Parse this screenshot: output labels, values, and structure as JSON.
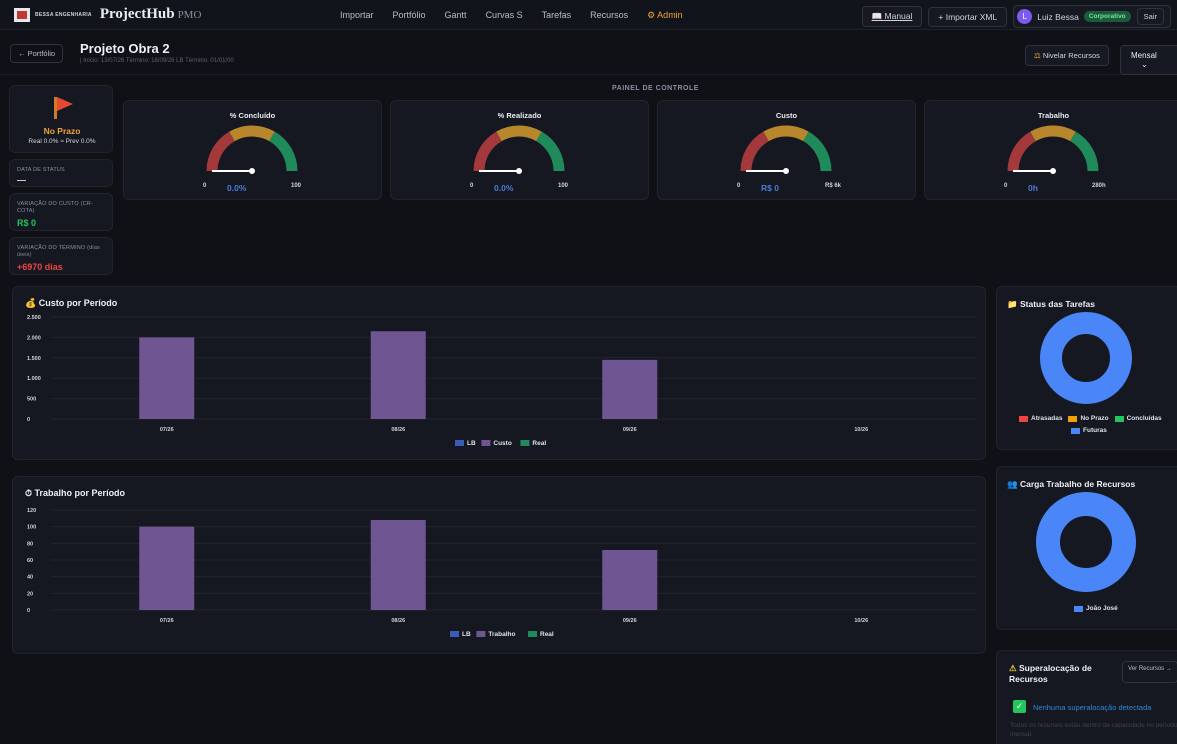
{
  "brand": {
    "small": "BESSA ENGENHARIA",
    "name_a": "Project",
    "name_b": "Hub",
    "suffix": "PMO"
  },
  "nav": {
    "items": [
      "Importar",
      "Portfólio",
      "Gantt",
      "Curvas S",
      "Tarefas",
      "Recursos"
    ],
    "admin": "⚙ Admin"
  },
  "top_actions": {
    "manual": "📖 Manual",
    "import_xml": "+ Importar XML",
    "avatar_letter": "L",
    "user_name": "Luiz Bessa",
    "plan_badge": "Corporativo",
    "logout": "Sair"
  },
  "project": {
    "back": "← Portfólio",
    "title": "Projeto Obra 2",
    "subtitle": "| Início: 13/07/26   Término: 18/09/26   LB Término: 01/01/00",
    "level_resources": "Nivelar Recursos",
    "period_select": "Mensal"
  },
  "status": {
    "label": "No Prazo",
    "detail": "Real 0.0% ≈ Prev 0.0%"
  },
  "info_cards": [
    {
      "label": "DATA DE STATUS",
      "value": "—",
      "color": "#d6d9e0"
    },
    {
      "label": "VARIAÇÃO DO CUSTO (CR-COTA)",
      "value": "R$ 0",
      "color": "#22c55e"
    },
    {
      "label": "VARIAÇÃO DO TÉRMINO (dias úteis)",
      "value": "+6970 dias",
      "color": "#ef4444"
    }
  ],
  "panel_title": "PAINEL DE CONTROLE",
  "gauges": [
    {
      "title": "% Concluído",
      "min": "0",
      "value": "0.0%",
      "max": "100",
      "fraction": 0
    },
    {
      "title": "% Realizado",
      "min": "0",
      "value": "0.0%",
      "max": "100",
      "fraction": 0
    },
    {
      "title": "Custo",
      "min": "0",
      "value": "R$ 0",
      "max": "R$ 6k",
      "fraction": 0
    },
    {
      "title": "Trabalho",
      "min": "0",
      "value": "0h",
      "max": "280h",
      "fraction": 0
    }
  ],
  "cost_chart_title": "Custo por Período",
  "work_chart_title": "Trabalho por Período",
  "chart_data": [
    {
      "type": "bar",
      "title": "Custo por Período",
      "categories": [
        "07/26",
        "08/26",
        "09/26",
        "10/26"
      ],
      "yticks": [
        "2.500",
        "2.000",
        "1.500",
        "1.000",
        "500",
        "0"
      ],
      "ylim": [
        0,
        2500
      ],
      "series": [
        {
          "name": "LB",
          "values": [
            0,
            0,
            0,
            0
          ],
          "color": "#3b5bb8"
        },
        {
          "name": "Custo",
          "values": [
            2000,
            2150,
            1450,
            0
          ],
          "color": "#6f5592"
        },
        {
          "name": "Real",
          "values": [
            0,
            0,
            0,
            0
          ],
          "color": "#1f8a5a"
        }
      ],
      "legend": "bottom-center"
    },
    {
      "type": "bar",
      "title": "Trabalho por Período",
      "categories": [
        "07/26",
        "08/26",
        "09/26",
        "10/26"
      ],
      "yticks": [
        "120",
        "100",
        "80",
        "60",
        "40",
        "20",
        "0"
      ],
      "ylim": [
        0,
        120
      ],
      "series": [
        {
          "name": "LB",
          "values": [
            0,
            0,
            0,
            0
          ],
          "color": "#3b5bb8"
        },
        {
          "name": "Trabalho",
          "values": [
            100,
            108,
            72,
            0
          ],
          "color": "#6f5592"
        },
        {
          "name": "Real",
          "values": [
            0,
            0,
            0,
            0
          ],
          "color": "#1f8a5a"
        }
      ],
      "legend": "bottom-center"
    },
    {
      "type": "pie",
      "title": "Status das Tarefas",
      "categories": [
        "Atrasadas",
        "No Prazo",
        "Concluídas",
        "Futuras"
      ],
      "values": [
        0,
        0,
        0,
        100
      ],
      "colors": [
        "#ef4444",
        "#f59e0b",
        "#22c55e",
        "#4a86f7"
      ]
    },
    {
      "type": "pie",
      "title": "Carga Trabalho de Recursos",
      "categories": [
        "João José"
      ],
      "values": [
        100
      ],
      "colors": [
        "#4a86f7"
      ]
    }
  ],
  "task_status_title": "Status das Tarefas",
  "resource_load_title": "Carga Trabalho de Recursos",
  "overalloc": {
    "title": "Superalocação de Recursos",
    "button": "Ver Recursos →",
    "ok": "Nenhuma superalocação detectada",
    "note": "Todos os recursos estão dentro da capacidade no período mensal."
  }
}
